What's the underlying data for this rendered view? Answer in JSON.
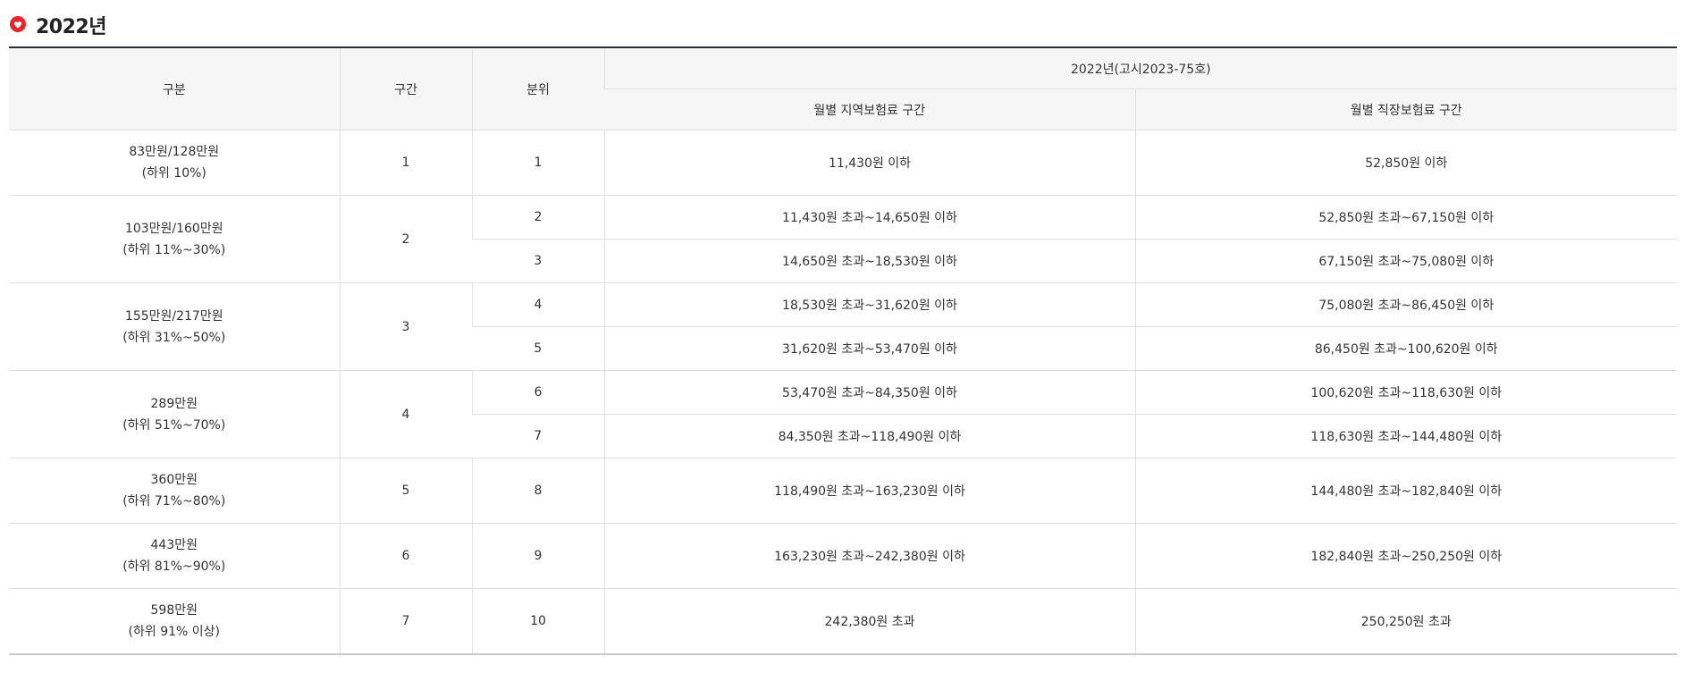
{
  "title": {
    "icon": "heart-speech-icon",
    "text": "2022년",
    "accent": "#e8242c"
  },
  "table": {
    "head": {
      "col_category": "구분",
      "col_section": "구간",
      "col_decile": "분위",
      "group_title": "2022년(고시2023-75호)",
      "col_regional": "월별 지역보험료 구간",
      "col_workplace": "월별 직장보험료 구간"
    },
    "groups": [
      {
        "income": "83만원/128만원",
        "range": "(하위 10%)",
        "section": "1",
        "rows": [
          {
            "decile": "1",
            "regional": "11,430원 이하",
            "workplace": "52,850원 이하"
          }
        ]
      },
      {
        "income": "103만원/160만원",
        "range": "(하위 11%~30%)",
        "section": "2",
        "rows": [
          {
            "decile": "2",
            "regional": "11,430원 초과~14,650원 이하",
            "workplace": "52,850원 초과~67,150원 이하"
          },
          {
            "decile": "3",
            "regional": "14,650원 초과~18,530원 이하",
            "workplace": "67,150원 초과~75,080원 이하"
          }
        ]
      },
      {
        "income": "155만원/217만원",
        "range": "(하위 31%~50%)",
        "section": "3",
        "rows": [
          {
            "decile": "4",
            "regional": "18,530원 초과~31,620원 이하",
            "workplace": "75,080원 초과~86,450원 이하"
          },
          {
            "decile": "5",
            "regional": "31,620원 초과~53,470원 이하",
            "workplace": "86,450원 초과~100,620원 이하"
          }
        ]
      },
      {
        "income": "289만원",
        "range": "(하위 51%~70%)",
        "section": "4",
        "rows": [
          {
            "decile": "6",
            "regional": "53,470원 초과~84,350원 이하",
            "workplace": "100,620원 초과~118,630원 이하"
          },
          {
            "decile": "7",
            "regional": "84,350원 초과~118,490원 이하",
            "workplace": "118,630원 초과~144,480원 이하"
          }
        ]
      },
      {
        "income": "360만원",
        "range": "(하위 71%~80%)",
        "section": "5",
        "rows": [
          {
            "decile": "8",
            "regional": "118,490원 초과~163,230원 이하",
            "workplace": "144,480원 초과~182,840원 이하"
          }
        ]
      },
      {
        "income": "443만원",
        "range": "(하위 81%~90%)",
        "section": "6",
        "rows": [
          {
            "decile": "9",
            "regional": "163,230원 초과~242,380원 이하",
            "workplace": "182,840원 초과~250,250원 이하"
          }
        ]
      },
      {
        "income": "598만원",
        "range": "(하위 91% 이상)",
        "section": "7",
        "rows": [
          {
            "decile": "10",
            "regional": "242,380원 초과",
            "workplace": "250,250원 초과"
          }
        ]
      }
    ]
  }
}
